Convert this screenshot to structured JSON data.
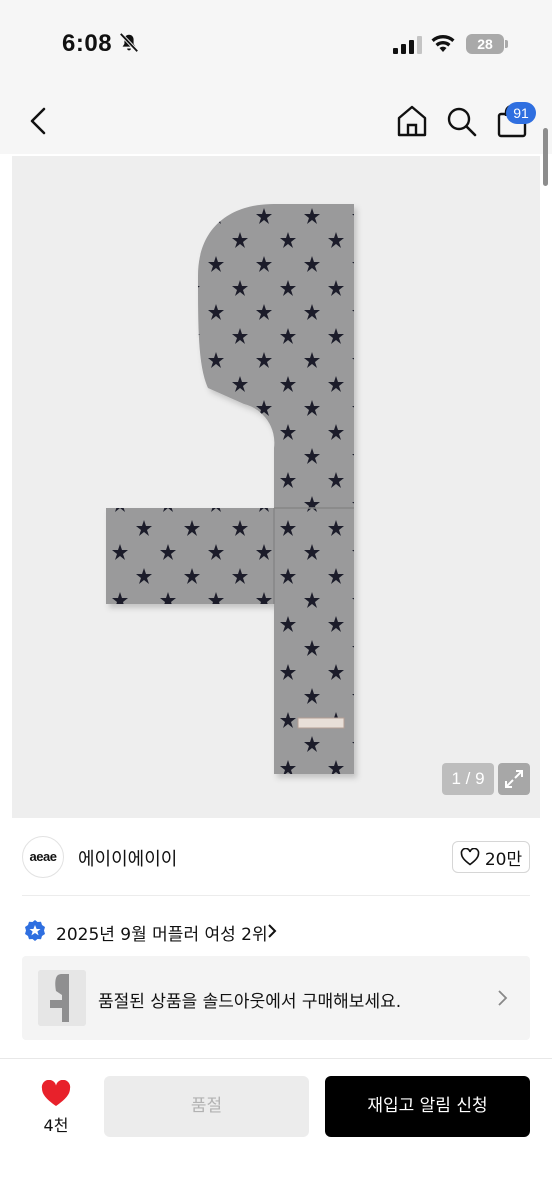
{
  "status_bar": {
    "time": "6:08",
    "battery": "28",
    "icons": [
      "bell-slash-icon",
      "signal-icon",
      "wifi-icon",
      "battery-icon"
    ]
  },
  "nav": {
    "icons": [
      "chevron-left-icon",
      "home-icon",
      "search-icon",
      "shopping-bag-icon"
    ],
    "cart_count": "91"
  },
  "gallery": {
    "counter": "1 / 9",
    "icons": [
      "expand-icon"
    ]
  },
  "brand": {
    "logo_text": "aeae",
    "name": "에이이에이이",
    "like_count": "20만",
    "icons": [
      "heart-outline-icon"
    ]
  },
  "ranking": {
    "text": "2025년 9월 머플러 여성 2위",
    "icons": [
      "rank-badge-icon",
      "chevron-right-icon"
    ]
  },
  "soldout_banner": {
    "text": "품절된 상품을 솔드아웃에서 구매해보세요."
  },
  "bottom_bar": {
    "wish_count": "4천",
    "soldout_label": "품절",
    "restock_label": "재입고 알림 신청",
    "icons": [
      "heart-filled-icon"
    ]
  },
  "colors": {
    "badge_blue": "#2f6fe0",
    "heart_red": "#e8212b",
    "primary_button": "#000000",
    "disabled_button": "#ececec"
  }
}
